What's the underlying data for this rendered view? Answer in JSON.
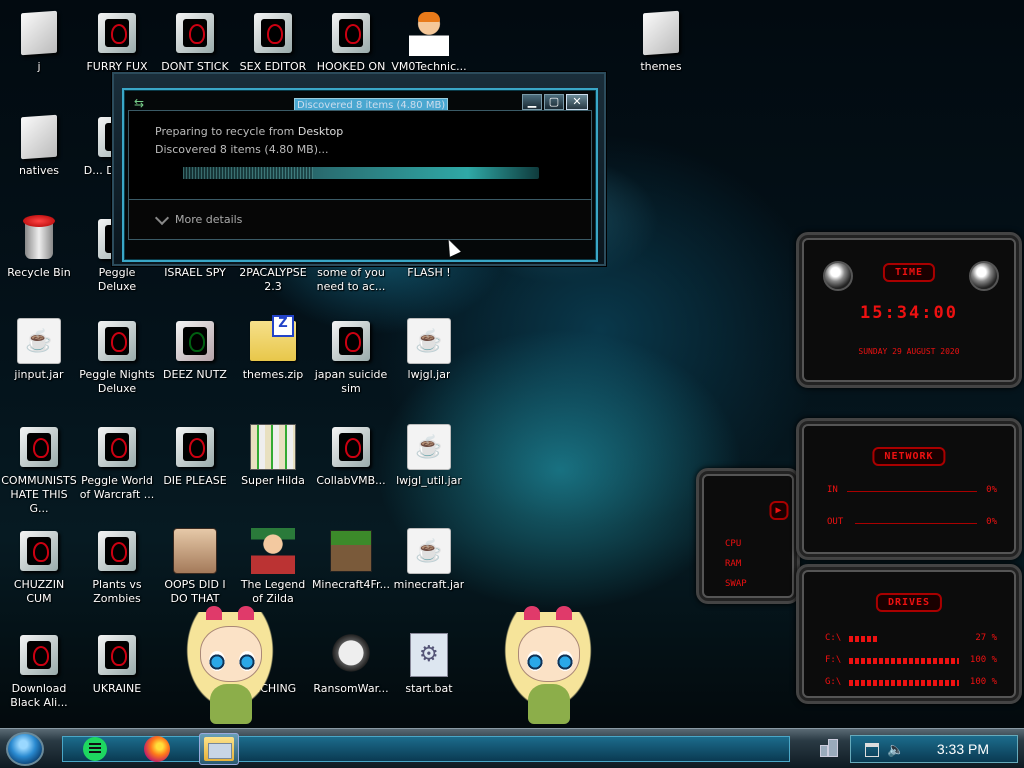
{
  "desktop": {
    "icons": [
      {
        "label": "j"
      },
      {
        "label": "FURRY FUX"
      },
      {
        "label": "DONT STICK"
      },
      {
        "label": "SEX EDITOR"
      },
      {
        "label": "HOOKED ON"
      },
      {
        "label": "VM0Technic..."
      },
      {
        "label": "themes"
      },
      {
        "label": "natives"
      },
      {
        "label": "D... DUMB..."
      },
      {
        "label": "Recycle Bin"
      },
      {
        "label": "Peggle Deluxe"
      },
      {
        "label": "ISRAEL SPY"
      },
      {
        "label": "2PACALYPSE 2.3"
      },
      {
        "label": "some of you need to ac..."
      },
      {
        "label": "FLASH !"
      },
      {
        "label": "jinput.jar"
      },
      {
        "label": "Peggle Nights Deluxe"
      },
      {
        "label": "DEEZ NUTZ"
      },
      {
        "label": "themes.zip"
      },
      {
        "label": "japan suicide sim"
      },
      {
        "label": "lwjgl.jar"
      },
      {
        "label": "COMMUNISTS HATE THIS G..."
      },
      {
        "label": "Peggle World of Warcraft ..."
      },
      {
        "label": "DIE PLEASE"
      },
      {
        "label": "Super Hilda"
      },
      {
        "label": "CollabVMB..."
      },
      {
        "label": "lwjgl_util.jar"
      },
      {
        "label": "CHUZZIN CUM"
      },
      {
        "label": "Plants vs Zombies"
      },
      {
        "label": "OOPS DID I DO THAT"
      },
      {
        "label": "The Legend of Zilda"
      },
      {
        "label": "Minecraft4Fr..."
      },
      {
        "label": "minecraft.jar"
      },
      {
        "label": "Download Black Ali..."
      },
      {
        "label": "UKRAINE"
      },
      {
        "label": "...CHING"
      },
      {
        "label": "RansomWar..."
      },
      {
        "label": "start.bat"
      }
    ]
  },
  "dialog": {
    "title": "Discovered 8 items (4.80 MB)",
    "line1_prefix": "Preparing to recycle from ",
    "line1_location": "Desktop",
    "line2": "Discovered 8 items (4.80 MB)...",
    "more_details": "More details",
    "close_glyph": "✕"
  },
  "gadgets": {
    "time": {
      "header": "TIME",
      "clock": "15:34:00",
      "date": "SUNDAY 29 AUGUST 2020"
    },
    "system": {
      "rows": [
        "CPU",
        "RAM",
        "SWAP"
      ]
    },
    "network": {
      "header": "NETWORK",
      "in_label": "IN",
      "in_value": "0%",
      "out_label": "OUT",
      "out_value": "0%"
    },
    "drives": {
      "header": "DRIVES",
      "items": [
        {
          "label": "C:\\",
          "value": "27 %",
          "fill": 0.27
        },
        {
          "label": "F:\\",
          "value": "100 %",
          "fill": 1.0
        },
        {
          "label": "G:\\",
          "value": "100 %",
          "fill": 1.0
        }
      ]
    }
  },
  "taskbar": {
    "apps": [
      {
        "name": "spotify-icon"
      },
      {
        "name": "firefox-icon"
      },
      {
        "name": "file-explorer-icon"
      }
    ],
    "clock": "3:33 PM"
  }
}
